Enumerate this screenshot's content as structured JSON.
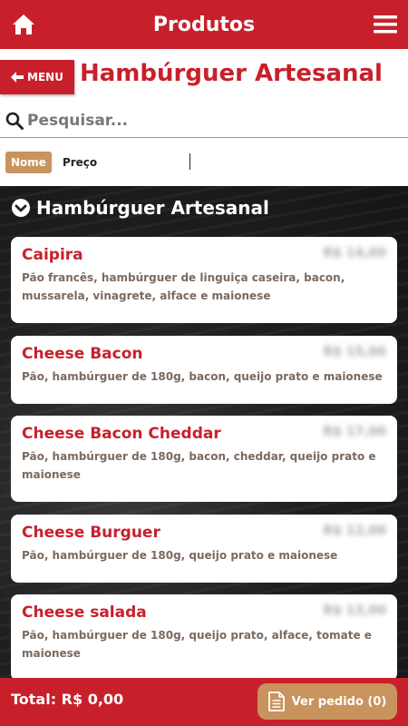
{
  "topbar": {
    "title": "Produtos",
    "home_icon": "home-icon",
    "menu_icon": "hamburger-menu-icon"
  },
  "subheader": {
    "menu_button": "MENU",
    "page_title": "Hambúrguer Artesanal"
  },
  "search": {
    "placeholder": "Pesquisar...",
    "value": ""
  },
  "sort": {
    "options": [
      "Nome",
      "Preço"
    ],
    "active": "Nome"
  },
  "section": {
    "title": "Hambúrguer Artesanal"
  },
  "products": [
    {
      "name": "Caipira",
      "price": "R$ 14,00",
      "description": "Pão francês, hambúrguer de linguiça caseira, bacon, mussarela, vinagrete, alface e maionese"
    },
    {
      "name": "Cheese Bacon",
      "price": "R$ 15,00",
      "description": "Pão, hambúrguer de 180g, bacon, queijo prato e maionese"
    },
    {
      "name": "Cheese Bacon Cheddar",
      "price": "R$ 17,00",
      "description": "Pão, hambúrguer de 180g, bacon, cheddar, queijo prato e maionese"
    },
    {
      "name": "Cheese Burguer",
      "price": "R$ 12,00",
      "description": "Pão, hambúrguer de 180g, queijo prato e maionese"
    },
    {
      "name": "Cheese salada",
      "price": "R$ 13,00",
      "description": "Pão, hambúrguer de 180g, queijo prato, alface, tomate e maionese"
    }
  ],
  "footer": {
    "total": "Total: R$ 0,00",
    "order_button": "Ver pedido (0)",
    "order_icon": "document-icon"
  },
  "colors": {
    "brand_red": "#c8202b",
    "accent_tan": "#c8935d",
    "description_text": "#7a6a60"
  }
}
